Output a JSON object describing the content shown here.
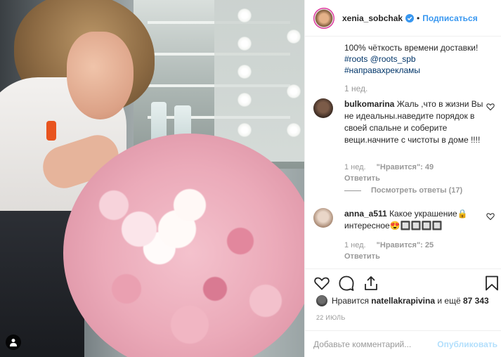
{
  "post": {
    "photo_alt": "",
    "user_tag_icon": "person-icon"
  },
  "header": {
    "username": "xenia_sobchak",
    "verified_icon": "verified-badge-icon",
    "separator": "•",
    "follow_label": "Подписаться"
  },
  "caption": {
    "text_line": "100% чёткость времени доставки!",
    "hashtag_roots": "#roots",
    "mention_roots_spb": "@roots_spb",
    "hashtag_ads": "#направахрекламы",
    "time": "1 нед."
  },
  "comments": [
    {
      "username": "bulkomarina",
      "text": "Жаль ,что в жизни Вы не идеальны.наведите порядок в своей спальне и соберите вещи.начните с чистоты в доме !!!!",
      "time": "1 нед.",
      "likes": "\"Нравится\": 49",
      "reply": "Ответить",
      "view_replies": "Посмотреть ответы (17)"
    },
    {
      "username": "anna_a511",
      "text": "Какое украшение🔒 интересное😍🔲🔲🔲🔲",
      "time": "1 нед.",
      "likes": "\"Нравится\": 25",
      "reply": "Ответить"
    }
  ],
  "actions": {
    "like_icon": "heart-icon",
    "comment_icon": "comment-icon",
    "share_icon": "share-icon",
    "save_icon": "bookmark-icon"
  },
  "likes_row": {
    "prefix": "Нравится",
    "liker": "natellakrapivina",
    "middle": "и ещё",
    "count": "87 343"
  },
  "date": "22 ИЮЛЬ",
  "add_comment": {
    "placeholder": "Добавьте комментарий...",
    "publish_label": "Опубликовать"
  },
  "colors": {
    "link_blue": "#3897f0",
    "hashtag": "#003569",
    "muted": "#999999",
    "publish_disabled": "#b2dffc"
  }
}
